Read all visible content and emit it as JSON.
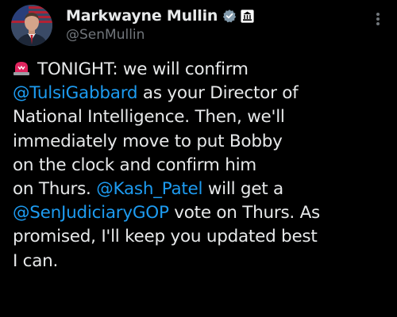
{
  "author": {
    "display_name": "Markwayne Mullin",
    "handle": "@SenMullin",
    "avatar_icon": "profile-photo",
    "verified_icon": "verified-badge-icon",
    "affiliation_icon": "government-building-icon"
  },
  "menu_icon": "more-options-icon",
  "tweet": {
    "emoji": "siren-icon",
    "lines": [
      [
        "TONIGHT: we will confirm"
      ],
      [
        "@TulsiGabbard",
        " as your Director of"
      ],
      [
        "National Intelligence. Then, we'll"
      ],
      [
        "immediately move to put Bobby"
      ],
      [
        "on the clock and confirm him"
      ],
      [
        "on Thurs. ",
        "@Kash_Patel",
        " will get a"
      ],
      [
        "@SenJudiciaryGOP",
        " vote on Thurs. As"
      ],
      [
        "promised, I'll keep you updated best"
      ],
      [
        "I can."
      ]
    ]
  },
  "colors": {
    "background": "#000000",
    "text": "#e7e9ea",
    "secondary": "#71767b",
    "link": "#1d9bf0",
    "verified": "#1d9bf0",
    "siren": "#e0245e"
  }
}
